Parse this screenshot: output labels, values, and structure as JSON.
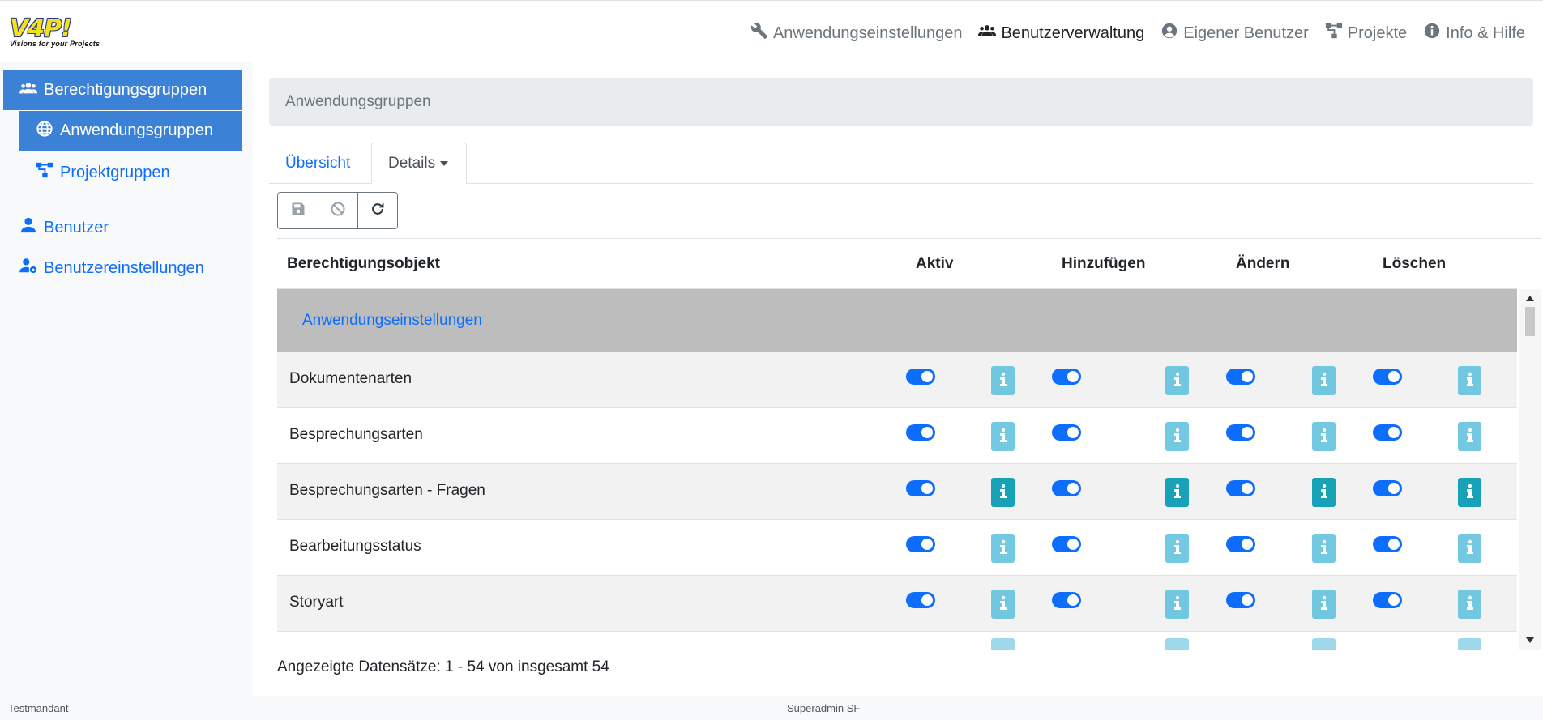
{
  "logo": {
    "mark": "V4P!",
    "tagline": "Visions for your Projects"
  },
  "topnav": [
    {
      "label": "Anwendungseinstellungen",
      "icon": "wrench-icon",
      "active": false
    },
    {
      "label": "Benutzerverwaltung",
      "icon": "users-icon",
      "active": true
    },
    {
      "label": "Eigener Benutzer",
      "icon": "user-circle-icon",
      "active": false
    },
    {
      "label": "Projekte",
      "icon": "project-tree-icon",
      "active": false
    },
    {
      "label": "Info & Hilfe",
      "icon": "info-circle-icon",
      "active": false
    }
  ],
  "sidebar": {
    "items": [
      {
        "label": "Berechtigungsgruppen",
        "icon": "users-icon"
      },
      {
        "label": "Anwendungsgruppen",
        "icon": "globe-icon"
      },
      {
        "label": "Projektgruppen",
        "icon": "project-tree-icon"
      },
      {
        "label": "Benutzer",
        "icon": "user-icon"
      },
      {
        "label": "Benutzereinstellungen",
        "icon": "user-cog-icon"
      }
    ]
  },
  "breadcrumb": "Anwendungsgruppen",
  "tabs": {
    "overview": "Übersicht",
    "details": "Details"
  },
  "toolbar": {
    "save": "save-icon",
    "cancel": "ban-icon",
    "reload": "reload-icon"
  },
  "table": {
    "headers": {
      "object": "Berechtigungsobjekt",
      "active": "Aktiv",
      "add": "Hinzufügen",
      "change": "Ändern",
      "delete": "Löschen"
    },
    "group": "Anwendungseinstellungen",
    "rows": [
      {
        "label": "Dokumentenarten",
        "active": true,
        "add": true,
        "change": true,
        "delete": true,
        "info_highlight": false
      },
      {
        "label": "Besprechungsarten",
        "active": true,
        "add": true,
        "change": true,
        "delete": true,
        "info_highlight": false
      },
      {
        "label": "Besprechungsarten - Fragen",
        "active": true,
        "add": true,
        "change": true,
        "delete": true,
        "info_highlight": true
      },
      {
        "label": "Bearbeitungsstatus",
        "active": true,
        "add": true,
        "change": true,
        "delete": true,
        "info_highlight": false
      },
      {
        "label": "Storyart",
        "active": true,
        "add": true,
        "change": true,
        "delete": true,
        "info_highlight": false
      }
    ]
  },
  "records": "Angezeigte Datensätze: 1 - 54 von insgesamt 54",
  "footer": {
    "tenant": "Testmandant",
    "user": "Superadmin SF"
  },
  "colors": {
    "primary": "#0d6efd",
    "info": "#5bc0de",
    "info_dark": "#17a2b8",
    "sidebar_active": "#3b82d6"
  }
}
